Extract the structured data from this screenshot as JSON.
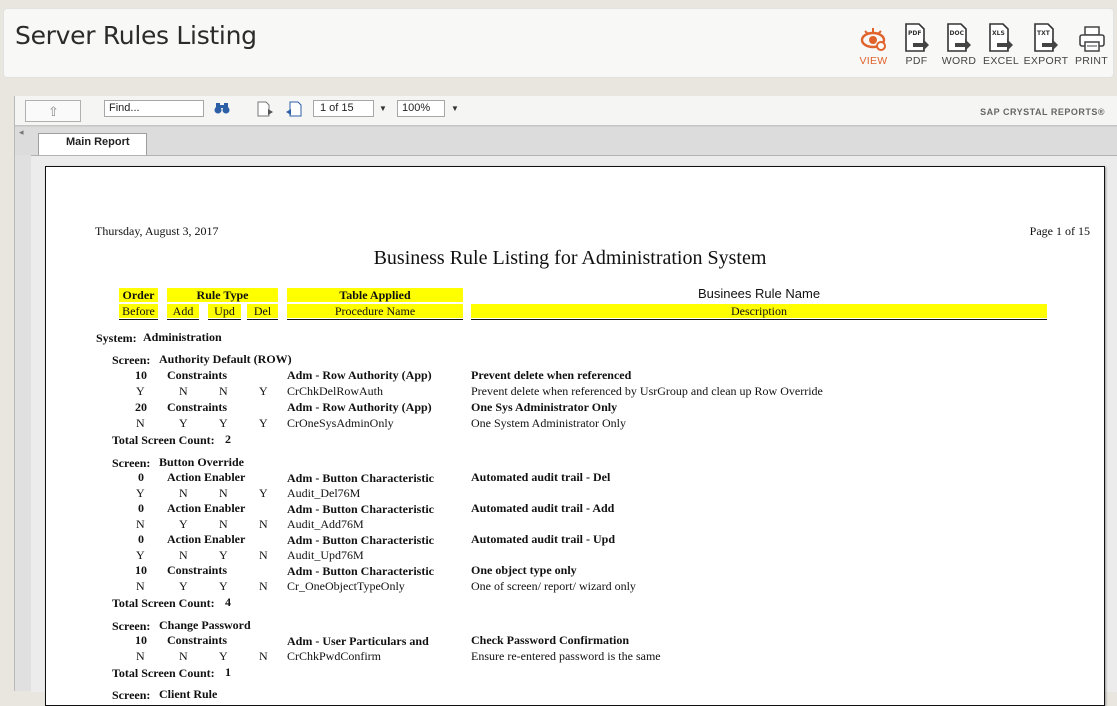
{
  "header": {
    "title": "Server Rules Listing",
    "tools": [
      {
        "label": "VIEW",
        "icon": "view-icon",
        "active": true
      },
      {
        "label": "PDF",
        "icon": "pdf-icon",
        "tag": "PDF"
      },
      {
        "label": "WORD",
        "icon": "word-icon",
        "tag": "DOC"
      },
      {
        "label": "EXCEL",
        "icon": "excel-icon",
        "tag": "XLS"
      },
      {
        "label": "EXPORT",
        "icon": "export-icon",
        "tag": "TXT"
      },
      {
        "label": "PRINT",
        "icon": "print-icon"
      }
    ],
    "accent_color": "#e0632b"
  },
  "viewer": {
    "find_placeholder": "Find...",
    "page_indicator": "1 of 15",
    "zoom": "100%",
    "brand": "SAP CRYSTAL REPORTS®",
    "tab_label": "Main Report"
  },
  "report": {
    "date": "Thursday, August 3, 2017",
    "page": "Page 1 of 15",
    "title": "Business Rule Listing for Administration System",
    "headers": {
      "order": "Order",
      "before": "Before",
      "rule_type": "Rule Type",
      "add": "Add",
      "upd": "Upd",
      "del": "Del",
      "table_applied": "Table Applied",
      "procedure_name": "Procedure Name",
      "rule_name": "Businees Rule Name",
      "description": "Description"
    },
    "highlight_color": "#ffff00",
    "system_label": "System:",
    "system_name": "Administration",
    "screen_label": "Screen:",
    "total_label": "Total Screen Count:",
    "screens": [
      {
        "name": "Authority Default (ROW)",
        "total": "2",
        "rules": [
          {
            "order": "10",
            "type": "Constraints",
            "table": "Adm - Row Authority (App)",
            "name": "Prevent delete when referenced",
            "before": "Y",
            "add": "N",
            "upd": "N",
            "del": "Y",
            "proc": "CrChkDelRowAuth",
            "desc": "Prevent delete when referenced by UsrGroup and clean up Row Override"
          },
          {
            "order": "20",
            "type": "Constraints",
            "table": "Adm - Row Authority (App)",
            "name": "One Sys Administrator Only",
            "before": "N",
            "add": "Y",
            "upd": "Y",
            "del": "Y",
            "proc": "CrOneSysAdminOnly",
            "desc": "One System Administrator Only"
          }
        ]
      },
      {
        "name": "Button Override",
        "total": "4",
        "rules": [
          {
            "order": "0",
            "type": "Action Enabler",
            "table": "Adm - Button Characteristic",
            "name": "Automated audit trail - Del",
            "before": "Y",
            "add": "N",
            "upd": "N",
            "del": "Y",
            "proc": "Audit_Del76M",
            "desc": ""
          },
          {
            "order": "0",
            "type": "Action Enabler",
            "table": "Adm - Button Characteristic",
            "name": "Automated audit trail - Add",
            "before": "N",
            "add": "Y",
            "upd": "N",
            "del": "N",
            "proc": "Audit_Add76M",
            "desc": ""
          },
          {
            "order": "0",
            "type": "Action Enabler",
            "table": "Adm - Button Characteristic",
            "name": "Automated audit trail - Upd",
            "before": "Y",
            "add": "N",
            "upd": "Y",
            "del": "N",
            "proc": "Audit_Upd76M",
            "desc": ""
          },
          {
            "order": "10",
            "type": "Constraints",
            "table": "Adm - Button Characteristic",
            "name": "One object type only",
            "before": "N",
            "add": "Y",
            "upd": "Y",
            "del": "N",
            "proc": "Cr_OneObjectTypeOnly",
            "desc": "One of screen/ report/ wizard only"
          }
        ]
      },
      {
        "name": "Change Password",
        "total": "1",
        "rules": [
          {
            "order": "10",
            "type": "Constraints",
            "table": "Adm - User Particulars and",
            "name": "Check Password Confirmation",
            "before": "N",
            "add": "N",
            "upd": "Y",
            "del": "N",
            "proc": "CrChkPwdConfirm",
            "desc": "Ensure re-entered password is the same"
          }
        ]
      },
      {
        "name": "Client Rule",
        "total": "",
        "rules": []
      }
    ]
  }
}
